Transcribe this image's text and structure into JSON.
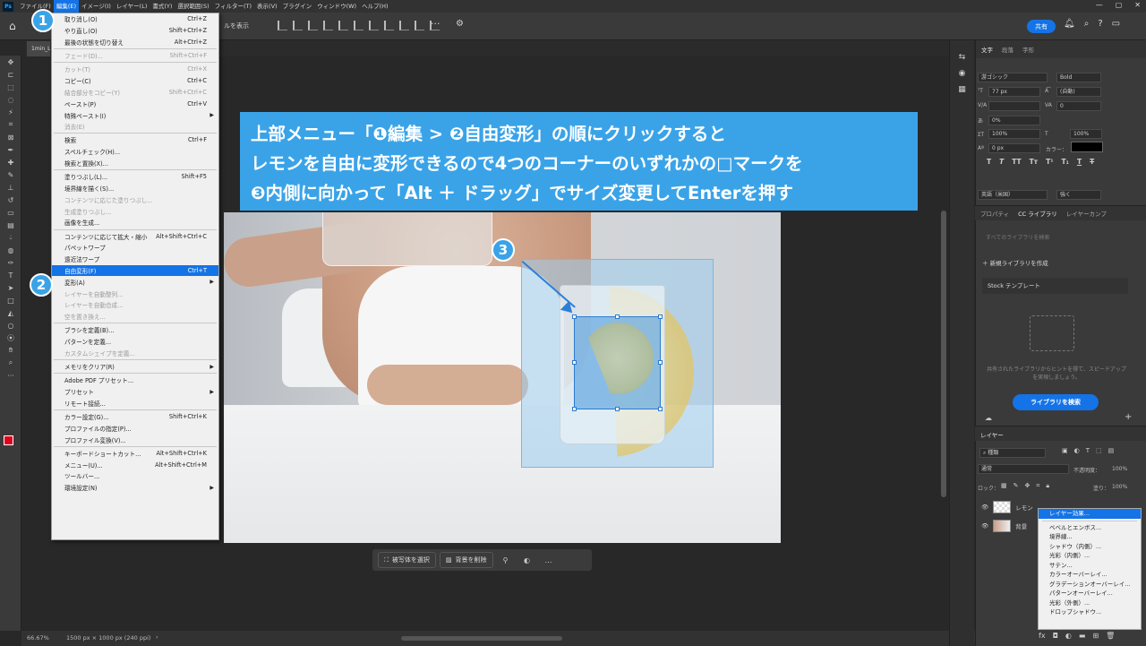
{
  "menubar": {
    "items": [
      "ファイル(F)",
      "編集(E)",
      "イメージ(I)",
      "レイヤー(L)",
      "書式(Y)",
      "選択範囲(S)",
      "フィルター(T)",
      "表示(V)",
      "プラグイン",
      "ウィンドウ(W)",
      "ヘルプ(H)"
    ]
  },
  "options": {
    "show_transform": "ルを表示",
    "share": "共有"
  },
  "doc_tab": "1min_L",
  "edit_menu": [
    {
      "label": "取り消し(O)",
      "shortcut": "Ctrl+Z",
      "state": "normal"
    },
    {
      "label": "やり直し(O)",
      "shortcut": "Shift+Ctrl+Z",
      "state": "normal"
    },
    {
      "label": "最後の状態を切り替え",
      "shortcut": "Alt+Ctrl+Z",
      "state": "normal"
    },
    {
      "sep": true
    },
    {
      "label": "フェード(D)...",
      "shortcut": "Shift+Ctrl+F",
      "state": "dis"
    },
    {
      "sep": true
    },
    {
      "label": "カット(T)",
      "shortcut": "Ctrl+X",
      "state": "dis"
    },
    {
      "label": "コピー(C)",
      "shortcut": "Ctrl+C",
      "state": "normal"
    },
    {
      "label": "結合部分をコピー(Y)",
      "shortcut": "Shift+Ctrl+C",
      "state": "dis"
    },
    {
      "label": "ペースト(P)",
      "shortcut": "Ctrl+V",
      "state": "normal"
    },
    {
      "label": "特殊ペースト(I)",
      "shortcut": "",
      "state": "normal",
      "sub": true
    },
    {
      "label": "消去(E)",
      "shortcut": "",
      "state": "dis"
    },
    {
      "sep": true
    },
    {
      "label": "検索",
      "shortcut": "Ctrl+F",
      "state": "normal"
    },
    {
      "label": "スペルチェック(H)...",
      "shortcut": "",
      "state": "normal"
    },
    {
      "label": "検索と置換(X)...",
      "shortcut": "",
      "state": "normal"
    },
    {
      "sep": true
    },
    {
      "label": "塗りつぶし(L)...",
      "shortcut": "Shift+F5",
      "state": "normal"
    },
    {
      "label": "境界線を描く(S)...",
      "shortcut": "",
      "state": "normal"
    },
    {
      "label": "コンテンツに応じた塗りつぶし...",
      "shortcut": "",
      "state": "dis"
    },
    {
      "label": "生成塗りつぶし...",
      "shortcut": "",
      "state": "dis"
    },
    {
      "label": "画像を生成...",
      "shortcut": "",
      "state": "normal"
    },
    {
      "sep": true
    },
    {
      "label": "コンテンツに応じて拡大・縮小",
      "shortcut": "Alt+Shift+Ctrl+C",
      "state": "normal"
    },
    {
      "label": "パペットワープ",
      "shortcut": "",
      "state": "normal"
    },
    {
      "label": "遠近法ワープ",
      "shortcut": "",
      "state": "normal"
    },
    {
      "label": "自由変形(F)",
      "shortcut": "Ctrl+T",
      "state": "hl"
    },
    {
      "label": "変形(A)",
      "shortcut": "",
      "state": "normal",
      "sub": true
    },
    {
      "label": "レイヤーを自動整列...",
      "shortcut": "",
      "state": "dis"
    },
    {
      "label": "レイヤーを自動合成...",
      "shortcut": "",
      "state": "dis"
    },
    {
      "label": "空を置き換え...",
      "shortcut": "",
      "state": "dis"
    },
    {
      "sep": true
    },
    {
      "label": "ブラシを定義(B)...",
      "shortcut": "",
      "state": "normal"
    },
    {
      "label": "パターンを定義...",
      "shortcut": "",
      "state": "normal"
    },
    {
      "label": "カスタムシェイプを定義...",
      "shortcut": "",
      "state": "dis"
    },
    {
      "sep": true
    },
    {
      "label": "メモリをクリア(R)",
      "shortcut": "",
      "state": "normal",
      "sub": true
    },
    {
      "sep": true
    },
    {
      "label": "Adobe PDF プリセット...",
      "shortcut": "",
      "state": "normal"
    },
    {
      "label": "プリセット",
      "shortcut": "",
      "state": "normal",
      "sub": true
    },
    {
      "label": "リモート接続...",
      "shortcut": "",
      "state": "normal"
    },
    {
      "sep": true
    },
    {
      "label": "カラー設定(G)...",
      "shortcut": "Shift+Ctrl+K",
      "state": "normal"
    },
    {
      "label": "プロファイルの指定(P)...",
      "shortcut": "",
      "state": "normal"
    },
    {
      "label": "プロファイル変換(V)...",
      "shortcut": "",
      "state": "normal"
    },
    {
      "sep": true
    },
    {
      "label": "キーボードショートカット...",
      "shortcut": "Alt+Shift+Ctrl+K",
      "state": "normal"
    },
    {
      "label": "メニュー(U)...",
      "shortcut": "Alt+Shift+Ctrl+M",
      "state": "normal"
    },
    {
      "label": "ツールバー...",
      "shortcut": "",
      "state": "normal"
    },
    {
      "label": "環境設定(N)",
      "shortcut": "",
      "state": "normal",
      "sub": true
    }
  ],
  "instruction": {
    "line1": "上部メニュー「❶編集 > ❷自由変形」の順にクリックすると",
    "line2": "レモンを自由に変形できるので4つのコーナーのいずれかの□マークを",
    "line3": "❸内側に向かって「Alt ＋ ドラッグ」でサイズ変更してEnterを押す"
  },
  "badges": {
    "one": "1",
    "two": "2",
    "three": "3"
  },
  "contextual_bar": {
    "select_subject": "被写体を選択",
    "remove_bg": "背景を削除",
    "more": "…"
  },
  "status": {
    "zoom": "66.67%",
    "doc_size": "1500 px × 1000 px (240 ppi)"
  },
  "character_panel": {
    "tabs": [
      "文字",
      "段落",
      "字形"
    ],
    "font": "游ゴシック",
    "style": "Bold",
    "size": "77 px",
    "leading": "(自動)",
    "kerning": "",
    "tracking": "0",
    "tsume": "0%",
    "vscale": "100%",
    "hscale": "100%",
    "baseline": "0 px",
    "color_label": "カラー：",
    "lang": "英語（米国）",
    "aa": "強く"
  },
  "library_panel": {
    "tabs": [
      "プロパティ",
      "CC ライブラリ",
      "レイヤーカンプ"
    ],
    "search": "すべてのライブラリを検索",
    "new_library": "新規ライブラリを作成",
    "stock": "Stock テンプレート",
    "hint": "共有されたライブラリからヒントを得て、スピードアップを実現しましょう。",
    "search_btn": "ライブラリを検索"
  },
  "layers_panel": {
    "tab": "レイヤー",
    "filter": "種類",
    "blend": "通常",
    "opacity_label": "不透明度：",
    "opacity": "100%",
    "lock_label": "ロック：",
    "fill_label": "塗り：",
    "fill": "100%",
    "layers": [
      {
        "name": "レモン"
      },
      {
        "name": "背景"
      }
    ]
  },
  "layer_context_menu": [
    "レイヤー効果...",
    "ベベルとエンボス...",
    "境界線...",
    "シャドウ（内側）...",
    "光彩（内側）...",
    "サテン...",
    "カラーオーバーレイ...",
    "グラデーションオーバーレイ...",
    "パターンオーバーレイ...",
    "光彩（外側）...",
    "ドロップシャドウ..."
  ]
}
